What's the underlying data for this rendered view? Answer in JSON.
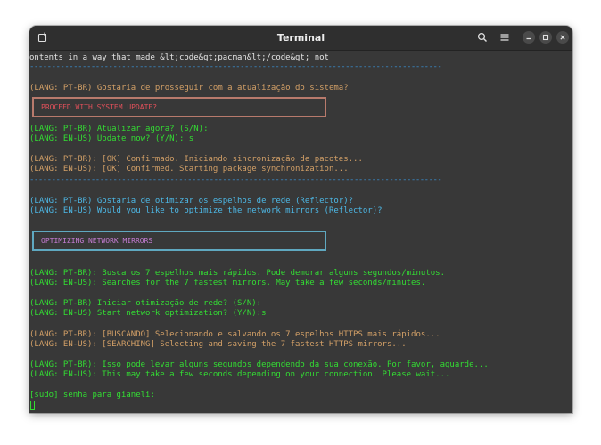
{
  "window": {
    "title": "Terminal"
  },
  "icons": {
    "new_tab": "new-tab-icon",
    "search": "search-icon",
    "menu": "hamburger-menu-icon",
    "minimize": "minimize-icon",
    "maximize": "maximize-icon",
    "close": "close-icon"
  },
  "colors": {
    "background": "#383838",
    "titlebar": "#2f2f2f",
    "orange": "#d3a067",
    "green": "#33dd33",
    "cyan": "#4db8e6",
    "separator": "#3a8fd1",
    "box_update_border": "#b87a6c",
    "box_update_text": "#e0505a",
    "box_mirrors_border": "#5fa8c0",
    "box_mirrors_text": "#c77dd6"
  },
  "terminal": {
    "line_top": "ontents in a way that made &lt;code&gt;pacman&lt;/code&gt; not",
    "separator": "----------------------------------------------------------------------------------------------",
    "q_update_pt": "(LANG: PT-BR) Gostaria de prosseguir com a atualização do sistema?",
    "box_update": "PROCEED WITH SYSTEM UPDATE?",
    "ask_update_pt": "(LANG: PT-BR) Atualizar agora? (S/N):",
    "ask_update_en": "(LANG: EN-US) Update now? (Y/N): s",
    "ok_pt": "(LANG: PT-BR): [OK] Confirmado. Iniciando sincronização de pacotes...",
    "ok_en": "(LANG: EN-US): [OK] Confirmed. Starting package synchronization...",
    "q_mirrors_pt": "(LANG: PT-BR) Gostaria de otimizar os espelhos de rede (Reflector)?",
    "q_mirrors_en": "(LANG: EN-US) Would you like to optimize the network mirrors (Reflector)?",
    "box_mirrors": "OPTIMIZING NETWORK MIRRORS",
    "search_pt": "(LANG: PT-BR): Busca os 7 espelhos mais rápidos. Pode demorar alguns segundos/minutos.",
    "search_en": "(LANG: EN-US): Searches for the 7 fastest mirrors. May take a few seconds/minutes.",
    "start_pt": "(LANG: PT-BR) Iniciar otimização de rede? (S/N):",
    "start_en": "(LANG: EN-US) Start network optimization? (Y/N):s",
    "searching_pt": "(LANG: PT-BR): [BUSCANDO] Selecionando e salvando os 7 espelhos HTTPS mais rápidos...",
    "searching_en": "(LANG: EN-US): [SEARCHING] Selecting and saving the 7 fastest HTTPS mirrors...",
    "wait_pt": "(LANG: PT-BR): Isso pode levar alguns segundos dependendo da sua conexão. Por favor, aguarde...",
    "wait_en": "(LANG: EN-US): This may take a few seconds depending on your connection. Please wait...",
    "sudo_prompt": "[sudo] senha para gianeli:"
  }
}
